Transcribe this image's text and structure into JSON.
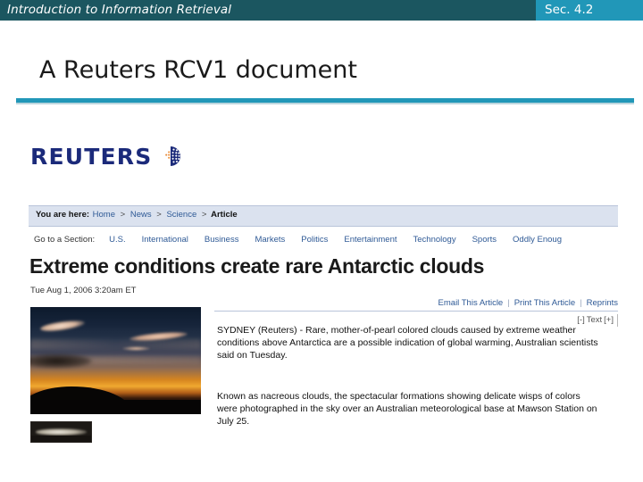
{
  "slide": {
    "header_title": "Introduction to Information Retrieval",
    "section_badge": "Sec. 4.2",
    "title": "A Reuters RCV1 document",
    "accent_color": "#2197b8",
    "header_color": "#1b5660"
  },
  "reuters": {
    "logo_text": "REUTERS",
    "logo_emblem": "reuters-dotted-globe-icon",
    "breadcrumb": {
      "lead": "You are here:",
      "items": [
        "Home",
        "News",
        "Science",
        "Article"
      ],
      "separator": ">",
      "current": "Article"
    },
    "section_nav": {
      "lead": "Go to a Section:",
      "items": [
        "U.S.",
        "International",
        "Business",
        "Markets",
        "Politics",
        "Entertainment",
        "Technology",
        "Sports",
        "Oddly Enoug"
      ]
    },
    "article": {
      "headline": "Extreme conditions create rare Antarctic clouds",
      "date": "Tue Aug 1, 2006 3:20am ET",
      "actions": [
        "Email This Article",
        "Print This Article",
        "Reprints"
      ],
      "action_separator": "|",
      "text_size": {
        "decrease": "[-]",
        "label": "Text",
        "increase": "[+]"
      },
      "paragraphs": [
        "SYDNEY (Reuters) - Rare, mother-of-pearl colored clouds caused by extreme weather conditions above Antarctica are a possible indication of global warming, Australian scientists said on Tuesday.",
        "Known as nacreous clouds, the spectacular formations showing delicate wisps of colors were photographed in the sky over an Australian meteorological base at Mawson Station on July 25."
      ],
      "photo_alt": "nacreous-clouds-sunset-photo",
      "thumbnail_alt": "nacreous-cloud-thumbnail"
    }
  }
}
